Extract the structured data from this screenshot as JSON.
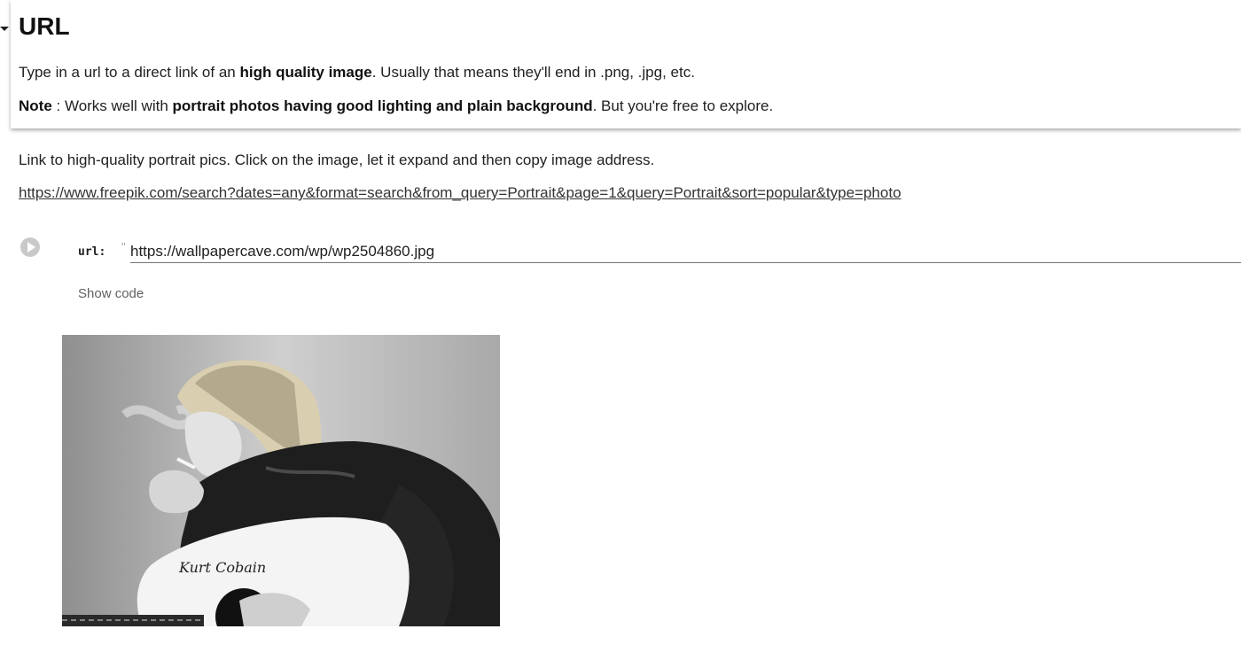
{
  "header_cell": {
    "title": "URL",
    "line1": {
      "before": "Type in a url to a direct link of an ",
      "bold": "high quality image",
      "after": ". Usually that means they'll end in .png, .jpg, etc."
    },
    "line2": {
      "note_label": "Note",
      "before": " : Works well with ",
      "bold": "portrait photos having good lighting and plain background",
      "after": ". But you're free to explore."
    }
  },
  "link_cell": {
    "description": "Link to high-quality portrait pics. Click on the image, let it expand and then copy image address.",
    "link_text": "https://www.freepik.com/search?dates=any&format=search&from_query=Portrait&page=1&query=Portrait&sort=popular&type=photo"
  },
  "form_cell": {
    "label": "url:",
    "quote": "\"",
    "url_value": "https://wallpapercave.com/wp/wp2504860.jpg",
    "show_code_label": "Show code"
  },
  "output": {
    "image_signature": "Kurt Cobain"
  },
  "colors": {
    "text": "#212121",
    "muted": "#616161",
    "run_button": "#c9c9c9"
  }
}
